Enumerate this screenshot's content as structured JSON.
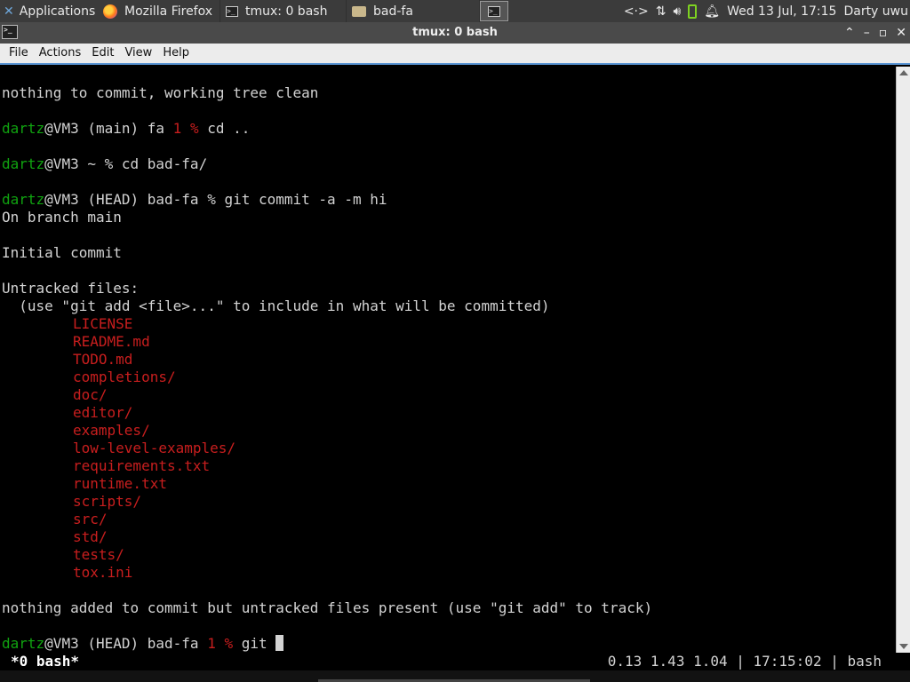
{
  "panel": {
    "apps_label": "Applications",
    "tasks": [
      {
        "label": "Mozilla Firefox",
        "icon": "firefox-icon"
      },
      {
        "label": "tmux: 0 bash",
        "icon": "terminal-icon"
      },
      {
        "label": "bad-fa",
        "icon": "folder-icon"
      }
    ],
    "clock": "Wed 13 Jul, 17:15",
    "user": "Darty uwu"
  },
  "window": {
    "title": "tmux: 0 bash",
    "menu": [
      "File",
      "Actions",
      "Edit",
      "View",
      "Help"
    ]
  },
  "terminal": {
    "l0": "nothing to commit, working tree clean",
    "user": "dartz",
    "host_main": "@VM3 (main) fa ",
    "num1": "1",
    "pct": " % ",
    "cmd_cd_up": "cd ..",
    "host_home": "@VM3 ~ % cd bad-fa/",
    "host_head": "@VM3 (HEAD) bad-fa % git commit -a -m hi",
    "on_branch": "On branch main",
    "initial": "Initial commit",
    "untracked": "Untracked files:",
    "hint": "  (use \"git add <file>...\" to include in what will be committed)",
    "files": [
      "LICENSE",
      "README.md",
      "TODO.md",
      "completions/",
      "doc/",
      "editor/",
      "examples/",
      "low-level-examples/",
      "requirements.txt",
      "runtime.txt",
      "scripts/",
      "src/",
      "std/",
      "tests/",
      "tox.ini"
    ],
    "nothing_added": "nothing added to commit but untracked files present (use \"git add\" to track)",
    "host_last": "@VM3 (HEAD) bad-fa ",
    "last_cmd": "git "
  },
  "status": {
    "left": "*0 bash*",
    "right": "0.13 1.43 1.04 | 17:15:02 | bash"
  }
}
